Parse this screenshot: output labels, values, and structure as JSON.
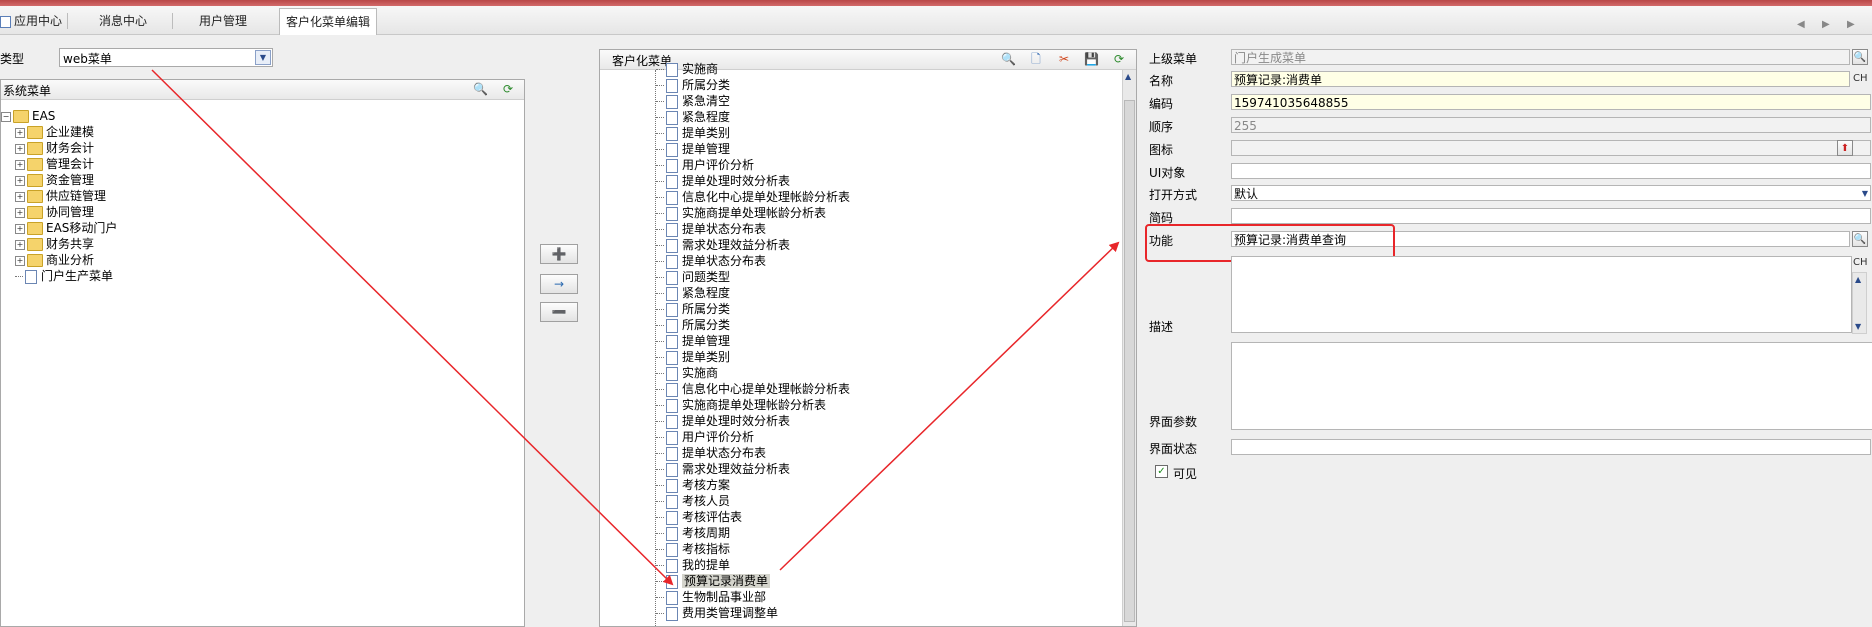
{
  "tabs": [
    {
      "label": "应用中心"
    },
    {
      "label": "消息中心"
    },
    {
      "label": "用户管理"
    },
    {
      "label": "客户化菜单编辑"
    }
  ],
  "left": {
    "type_label": "类型",
    "type_value": "web菜单",
    "system_menu_title": "系统菜单",
    "tree": [
      {
        "label": "EAS",
        "kind": "root"
      },
      {
        "label": "企业建模",
        "kind": "folder"
      },
      {
        "label": "财务会计",
        "kind": "folder"
      },
      {
        "label": "管理会计",
        "kind": "folder"
      },
      {
        "label": "资金管理",
        "kind": "folder"
      },
      {
        "label": "供应链管理",
        "kind": "folder"
      },
      {
        "label": "协同管理",
        "kind": "folder"
      },
      {
        "label": "EAS移动门户",
        "kind": "folder"
      },
      {
        "label": "财务共享",
        "kind": "folder"
      },
      {
        "label": "商业分析",
        "kind": "folder"
      },
      {
        "label": "门户生产菜单",
        "kind": "doc"
      }
    ]
  },
  "middle": {
    "title": "客户化菜单",
    "items": [
      "实施商",
      "所属分类",
      "紧急清空",
      "紧急程度",
      "提单类别",
      "提单管理",
      "用户评价分析",
      "提单处理时效分析表",
      "信息化中心提单处理帐龄分析表",
      "实施商提单处理帐龄分析表",
      "提单状态分布表",
      "需求处理效益分析表",
      "提单状态分布表",
      "问题类型",
      "紧急程度",
      "所属分类",
      "所属分类",
      "提单管理",
      "提单类别",
      "实施商",
      "信息化中心提单处理帐龄分析表",
      "实施商提单处理帐龄分析表",
      "提单处理时效分析表",
      "用户评价分析",
      "提单状态分布表",
      "需求处理效益分析表",
      "考核方案",
      "考核人员",
      "考核评估表",
      "考核周期",
      "考核指标",
      "我的提单",
      "预算记录消费单",
      "生物制品事业部",
      "费用类管理调整单"
    ],
    "selected_index": 32,
    "btn_add_icon": "add-node-icon",
    "btn_move_icon": "arrow-right-icon",
    "btn_remove_icon": "remove-node-icon"
  },
  "right": {
    "labels": {
      "parent": "上级菜单",
      "name": "名称",
      "code": "编码",
      "order": "顺序",
      "icon": "图标",
      "ui_object": "UI对象",
      "open_mode": "打开方式",
      "shortcut": "简码",
      "function": "功能",
      "description": "描述",
      "ui_params": "界面参数",
      "ui_state": "界面状态",
      "visible": "可见"
    },
    "values": {
      "parent": "门户生成菜单",
      "name": "预算记录:消费单",
      "code": "159741035648855",
      "order": "255",
      "icon": "",
      "ui_object": "",
      "open_mode": "默认",
      "shortcut": "",
      "function": "预算记录:消费单查询",
      "description": "",
      "ui_params": "",
      "ui_state": ""
    },
    "ch_tag": "CH",
    "visible_checked": true
  },
  "colors": {
    "highlight": "#e8262a",
    "topbar": "#c45656"
  }
}
